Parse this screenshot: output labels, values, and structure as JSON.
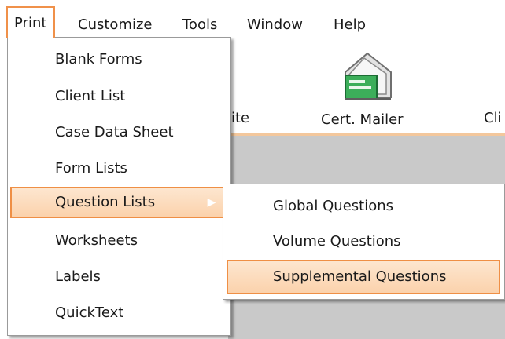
{
  "menubar": {
    "items": [
      {
        "label": "Print"
      },
      {
        "label": "Customize"
      },
      {
        "label": "Tools"
      },
      {
        "label": "Window"
      },
      {
        "label": "Help"
      }
    ]
  },
  "toolbar": {
    "partial_left_label": "ite",
    "cert_mailer_label": "Cert. Mailer",
    "partial_right_label": "Cli"
  },
  "print_menu": {
    "items": [
      {
        "label": "Blank Forms"
      },
      {
        "label": "Client List"
      },
      {
        "label": "Case Data Sheet"
      },
      {
        "label": "Form Lists"
      },
      {
        "label": "Question Lists",
        "has_submenu": true,
        "highlighted": true
      },
      {
        "label": "Worksheets"
      },
      {
        "label": "Labels"
      },
      {
        "label": "QuickText"
      }
    ]
  },
  "question_lists_submenu": {
    "items": [
      {
        "label": "Global Questions"
      },
      {
        "label": "Volume Questions"
      },
      {
        "label": "Supplemental Questions",
        "highlighted": true
      }
    ]
  },
  "colors": {
    "highlight_border": "#ef8f45",
    "highlight_fill": "#fbd2ac",
    "workspace": "#c9c9c9"
  },
  "icons": {
    "cert_mailer": "envelope-stack-icon",
    "submenu_arrow": "triangle-right-icon"
  }
}
